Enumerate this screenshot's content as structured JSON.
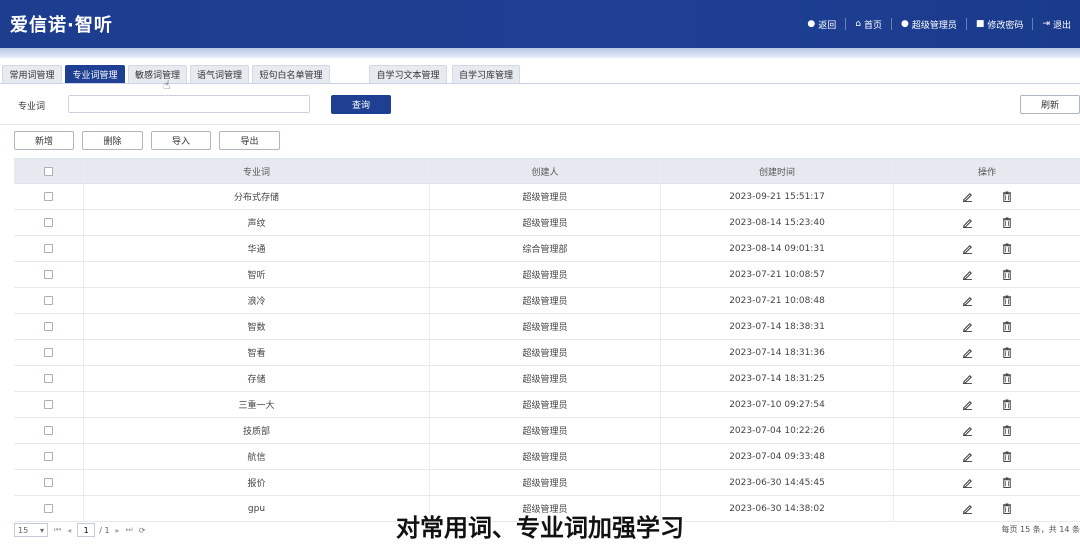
{
  "header": {
    "title": "爱信诺·智听",
    "nav": [
      {
        "icon": "back-icon",
        "label": "返回"
      },
      {
        "icon": "home-icon",
        "label": "首页"
      },
      {
        "icon": "user-icon",
        "label": "超级管理员"
      },
      {
        "icon": "lock-icon",
        "label": "修改密码"
      },
      {
        "icon": "logout-icon",
        "label": "退出"
      }
    ]
  },
  "tabs": [
    "常用词管理",
    "专业词管理",
    "敏感词管理",
    "语气词管理",
    "短句白名单管理",
    "自学习文本管理",
    "自学习库管理"
  ],
  "active_tab": "专业词管理",
  "search": {
    "label": "专业词",
    "value": "",
    "placeholder": "",
    "query_button": "查询",
    "refresh_button": "刷新"
  },
  "actions": {
    "add": "新增",
    "delete": "删除",
    "import": "导入",
    "export": "导出"
  },
  "table": {
    "columns": [
      "专业词",
      "创建人",
      "创建时间",
      "操作"
    ],
    "rows": [
      {
        "word": "分布式存储",
        "creator": "超级管理员",
        "time": "2023-09-21 15:51:17"
      },
      {
        "word": "声纹",
        "creator": "超级管理员",
        "time": "2023-08-14 15:23:40"
      },
      {
        "word": "华通",
        "creator": "综合管理部",
        "time": "2023-08-14 09:01:31"
      },
      {
        "word": "智听",
        "creator": "超级管理员",
        "time": "2023-07-21 10:08:57"
      },
      {
        "word": "浪冷",
        "creator": "超级管理员",
        "time": "2023-07-21 10:08:48"
      },
      {
        "word": "智数",
        "creator": "超级管理员",
        "time": "2023-07-14 18:38:31"
      },
      {
        "word": "智看",
        "creator": "超级管理员",
        "time": "2023-07-14 18:31:36"
      },
      {
        "word": "存储",
        "creator": "超级管理员",
        "time": "2023-07-14 18:31:25"
      },
      {
        "word": "三重一大",
        "creator": "超级管理员",
        "time": "2023-07-10 09:27:54"
      },
      {
        "word": "技质部",
        "creator": "超级管理员",
        "time": "2023-07-04 10:22:26"
      },
      {
        "word": "航信",
        "creator": "超级管理员",
        "time": "2023-07-04 09:33:48"
      },
      {
        "word": "报价",
        "creator": "超级管理员",
        "time": "2023-06-30 14:45:45"
      },
      {
        "word": "gpu",
        "creator": "超级管理员",
        "time": "2023-06-30 14:38:02"
      }
    ]
  },
  "pager": {
    "page_size": "15",
    "current_page": "1",
    "total_pages": "/ 1",
    "info": "每页 15 条，共 14 条"
  },
  "caption": "对常用词、专业词加强学习",
  "colors": {
    "primary": "#1f3f92",
    "header_bg": "#1e3f94"
  }
}
